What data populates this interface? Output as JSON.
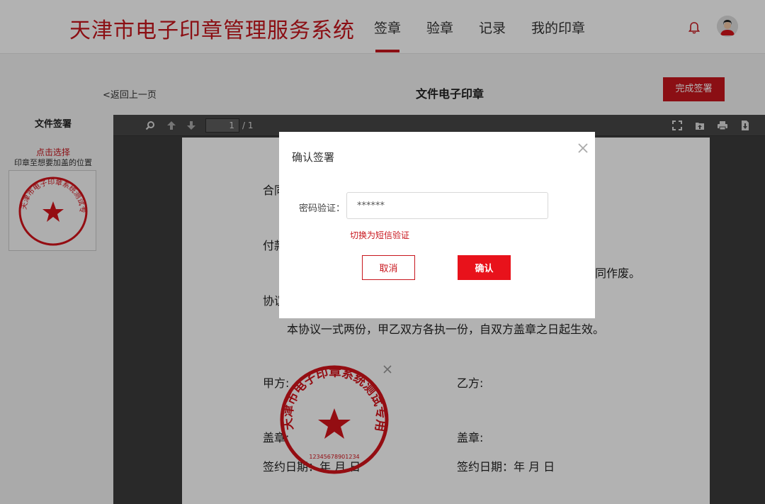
{
  "header": {
    "app_title": "天津市电子印章管理服务系统",
    "nav": [
      {
        "label": "签章",
        "active": true
      },
      {
        "label": "验章",
        "active": false
      },
      {
        "label": "记录",
        "active": false
      },
      {
        "label": "我的印章",
        "active": false
      }
    ]
  },
  "subbar": {
    "back_label": "<返回上一页",
    "doc_title": "文件电子印章",
    "finish_label": "完成签署"
  },
  "left_panel": {
    "title": "文件签署",
    "hint_select": "点击选择",
    "hint_place": "印章至想要加盖的位置"
  },
  "seal": {
    "ring_text": "天津市电子印章系统测试专用章（1）",
    "serial": "12345678901234",
    "color": "#d4131b"
  },
  "viewer": {
    "page_current": "1",
    "page_total": "/ 1"
  },
  "document": {
    "line_contract": "合同",
    "line_payment": "付款",
    "line_void": "同作废。",
    "line_agreement": "协议",
    "line_copies": "本协议一式两份，甲乙双方各执一份，自双方盖章之日起生效。",
    "party_a": "甲方:",
    "party_b": "乙方:",
    "stamp_a": "盖章:",
    "stamp_b": "盖章:",
    "date_a": "签约日期：年 月 日",
    "date_b": "签约日期：年  月  日"
  },
  "modal": {
    "title": "确认签署",
    "password_label": "密码验证：",
    "password_value": "******",
    "switch_sms": "切换为短信验证",
    "cancel_label": "取消",
    "confirm_label": "确认"
  },
  "colors": {
    "brand_red": "#c8161d",
    "confirm_red": "#e8121b"
  }
}
